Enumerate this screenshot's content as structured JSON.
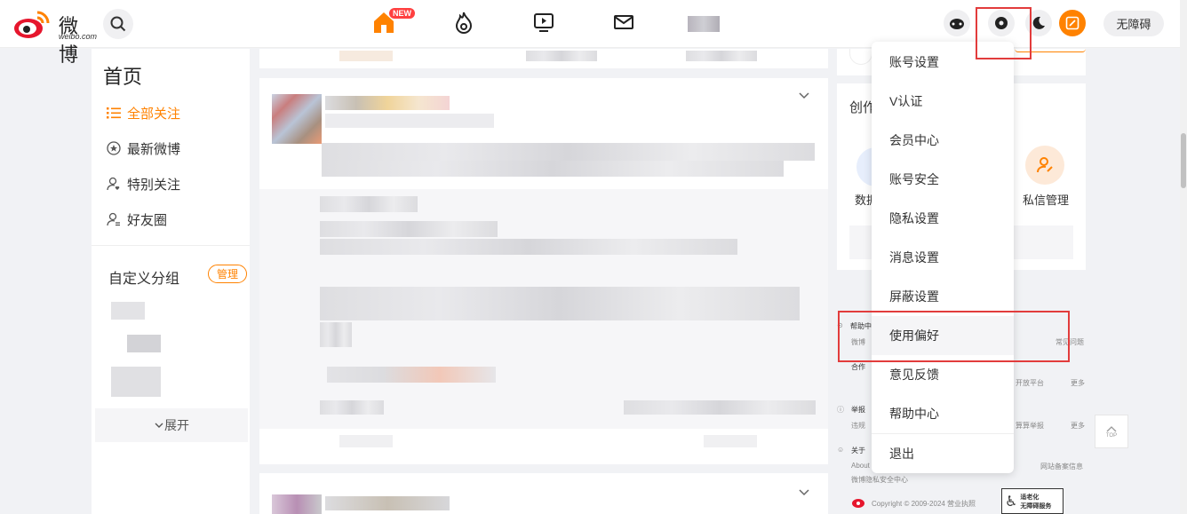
{
  "header": {
    "logo_text": "微博",
    "logo_sub": "weibo.com",
    "new_badge": "NEW",
    "accessibility_label": "无障碍"
  },
  "sidebar": {
    "title": "首页",
    "items": [
      {
        "label": "全部关注",
        "active": true
      },
      {
        "label": "最新微博",
        "active": false
      },
      {
        "label": "特别关注",
        "active": false
      },
      {
        "label": "好友圈",
        "active": false
      }
    ],
    "group_title": "自定义分组",
    "manage_label": "管理",
    "expand_label": "展开"
  },
  "right_panel": {
    "creator_title_partial": "创作",
    "data_label_partial": "数据",
    "dm_label": "私信管理",
    "help_partial": "帮助中",
    "help_sub": "微博",
    "common_issue": "常见问题",
    "coop_partial": "合作",
    "open_platform": "开放平台",
    "more1": "更多",
    "report_partial": "举报",
    "report_sub": "违规",
    "admin_report": "算算举报",
    "more2": "更多",
    "about_partial": "关于",
    "about_sub": "About",
    "icp": "网站备案信息",
    "privacy_center": "微博隐私安全中心",
    "copyright": "Copyright © 2009-2024 营业执照",
    "a11y_badge_line1": "适老化",
    "a11y_badge_line2": "无障碍服务",
    "top_label": "TOP"
  },
  "settings_menu": {
    "items": [
      "账号设置",
      "V认证",
      "会员中心",
      "账号安全",
      "隐私设置",
      "消息设置",
      "屏蔽设置",
      "使用偏好",
      "意见反馈",
      "帮助中心",
      "退出"
    ],
    "highlighted": "使用偏好"
  },
  "colors": {
    "accent": "#ff8200",
    "annotation_red": "#e23c3c"
  }
}
